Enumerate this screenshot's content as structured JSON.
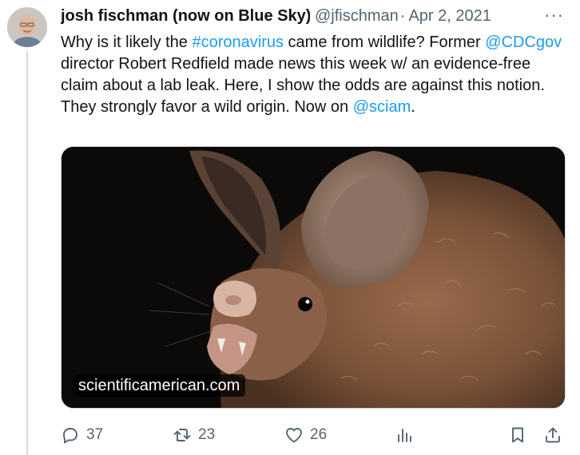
{
  "author": {
    "display_name": "josh fischman (now on Blue Sky)",
    "handle": "@jfischman",
    "separator": "·",
    "date": "Apr 2, 2021",
    "more_glyph": "···"
  },
  "tweet": {
    "segments": [
      {
        "text": "Why is it likely the ",
        "type": "text"
      },
      {
        "text": "#coronavirus",
        "type": "link"
      },
      {
        "text": " came from wildlife? Former ",
        "type": "text"
      },
      {
        "text": "@CDCgov",
        "type": "link"
      },
      {
        "text": " director Robert Redfield made news this week w/ an evidence-free claim about a lab leak. Here, I show the odds are against this notion. They strongly favor a wild origin. Now on ",
        "type": "text"
      },
      {
        "text": "@sciam",
        "type": "link"
      },
      {
        "text": ".",
        "type": "text"
      }
    ]
  },
  "media": {
    "caption": "scientificamerican.com",
    "subject": "bat-photo"
  },
  "actions": {
    "reply_count": "37",
    "retweet_count": "23",
    "like_count": "26"
  },
  "colors": {
    "link": "#1d9bf0",
    "muted": "#536471",
    "text": "#0f1419"
  },
  "icons": [
    "reply-icon",
    "retweet-icon",
    "like-icon",
    "views-icon",
    "bookmark-icon",
    "share-icon",
    "more-icon"
  ]
}
